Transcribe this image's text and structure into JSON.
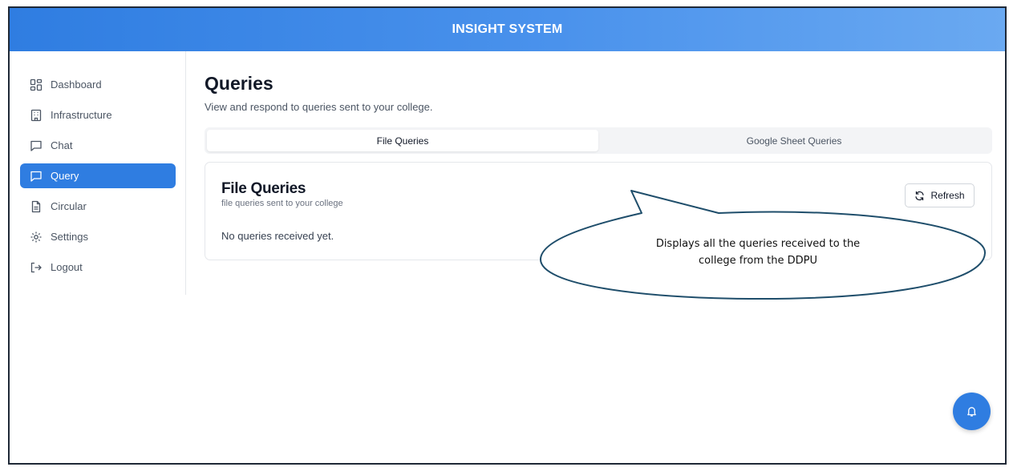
{
  "header": {
    "title": "INSIGHT SYSTEM"
  },
  "sidebar": {
    "items": [
      {
        "label": "Dashboard",
        "icon": "dashboard-grid-icon"
      },
      {
        "label": "Infrastructure",
        "icon": "building-icon"
      },
      {
        "label": "Chat",
        "icon": "chat-bubble-icon"
      },
      {
        "label": "Query",
        "icon": "chat-bubble-icon",
        "active": true
      },
      {
        "label": "Circular",
        "icon": "document-icon"
      },
      {
        "label": "Settings",
        "icon": "gear-icon"
      },
      {
        "label": "Logout",
        "icon": "logout-icon"
      }
    ]
  },
  "main": {
    "title": "Queries",
    "subtitle": "View and respond to queries sent to your college.",
    "tabs": [
      {
        "label": "File Queries",
        "active": true
      },
      {
        "label": "Google Sheet Queries",
        "active": false
      }
    ],
    "card": {
      "title": "File Queries",
      "subtitle": "file queries sent to your college",
      "empty_message": "No queries received yet.",
      "refresh_label": "Refresh"
    }
  },
  "callout": {
    "line1": "Displays all the queries received to the",
    "line2": "college from the DDPU"
  },
  "colors": {
    "accent": "#2f7de1",
    "header_gradient_end": "#6aa9f1",
    "callout_stroke": "#1f4e6b"
  },
  "floating": {
    "icon": "bell-icon"
  }
}
